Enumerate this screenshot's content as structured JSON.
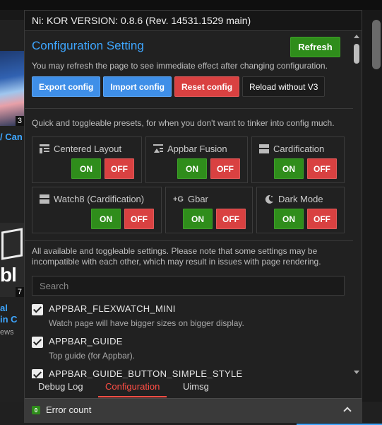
{
  "background": {
    "video1_duration": "3",
    "video1_title_fragment": "/ Can",
    "video2_thumb_text": "bl",
    "video2_badge": "7",
    "video2_title_line1": "al",
    "video2_title_line2": "in C",
    "video2_meta": "ews"
  },
  "popup": {
    "title": "Ni: KOR VERSION: 0.8.6 (Rev. 14531.1529 main)",
    "config_title": "Configuration Setting",
    "refresh_label": "Refresh",
    "refresh_hint": "You may refresh the page to see immediate effect after changing configuration.",
    "actions": {
      "export": "Export config",
      "import": "Import config",
      "reset": "Reset config",
      "reload": "Reload without V3"
    },
    "presets_desc": "Quick and toggleable presets, for when you don't want to tinker into config much.",
    "on_label": "ON",
    "off_label": "OFF",
    "presets": [
      {
        "name": "Centered Layout",
        "icon": "centered-layout-icon"
      },
      {
        "name": "Appbar Fusion",
        "icon": "appbar-fusion-icon"
      },
      {
        "name": "Cardification",
        "icon": "cardification-icon"
      },
      {
        "name": "Watch8 (Cardification)",
        "icon": "watch8-icon"
      },
      {
        "name": "Gbar",
        "icon": "gbar-icon"
      },
      {
        "name": "Dark Mode",
        "icon": "moon-icon"
      }
    ],
    "gbar_icon_text": "+G",
    "settings_desc": "All available and toggleable settings. Please note that some settings may be incompatible with each other, which may result in issues with page rendering.",
    "search_placeholder": "Search",
    "settings": [
      {
        "name": "APPBAR_FLEXWATCH_MINI",
        "desc": "Watch page will have bigger sizes on bigger display.",
        "checked": true
      },
      {
        "name": "APPBAR_GUIDE",
        "desc": "Top guide (for Appbar).",
        "checked": true
      },
      {
        "name": "APPBAR_GUIDE_BUTTON_SIMPLE_STYLE",
        "desc": "",
        "checked": true
      }
    ],
    "tabs": [
      "Debug Log",
      "Configuration",
      "Uimsg"
    ],
    "active_tab": "Configuration",
    "error_count_value": "0",
    "error_count_label": "Error count"
  },
  "colors": {
    "accent_blue": "#3ea6ff",
    "on_green": "#2f8d1b",
    "off_red": "#d94141",
    "tab_active_red": "#ff4e45"
  }
}
